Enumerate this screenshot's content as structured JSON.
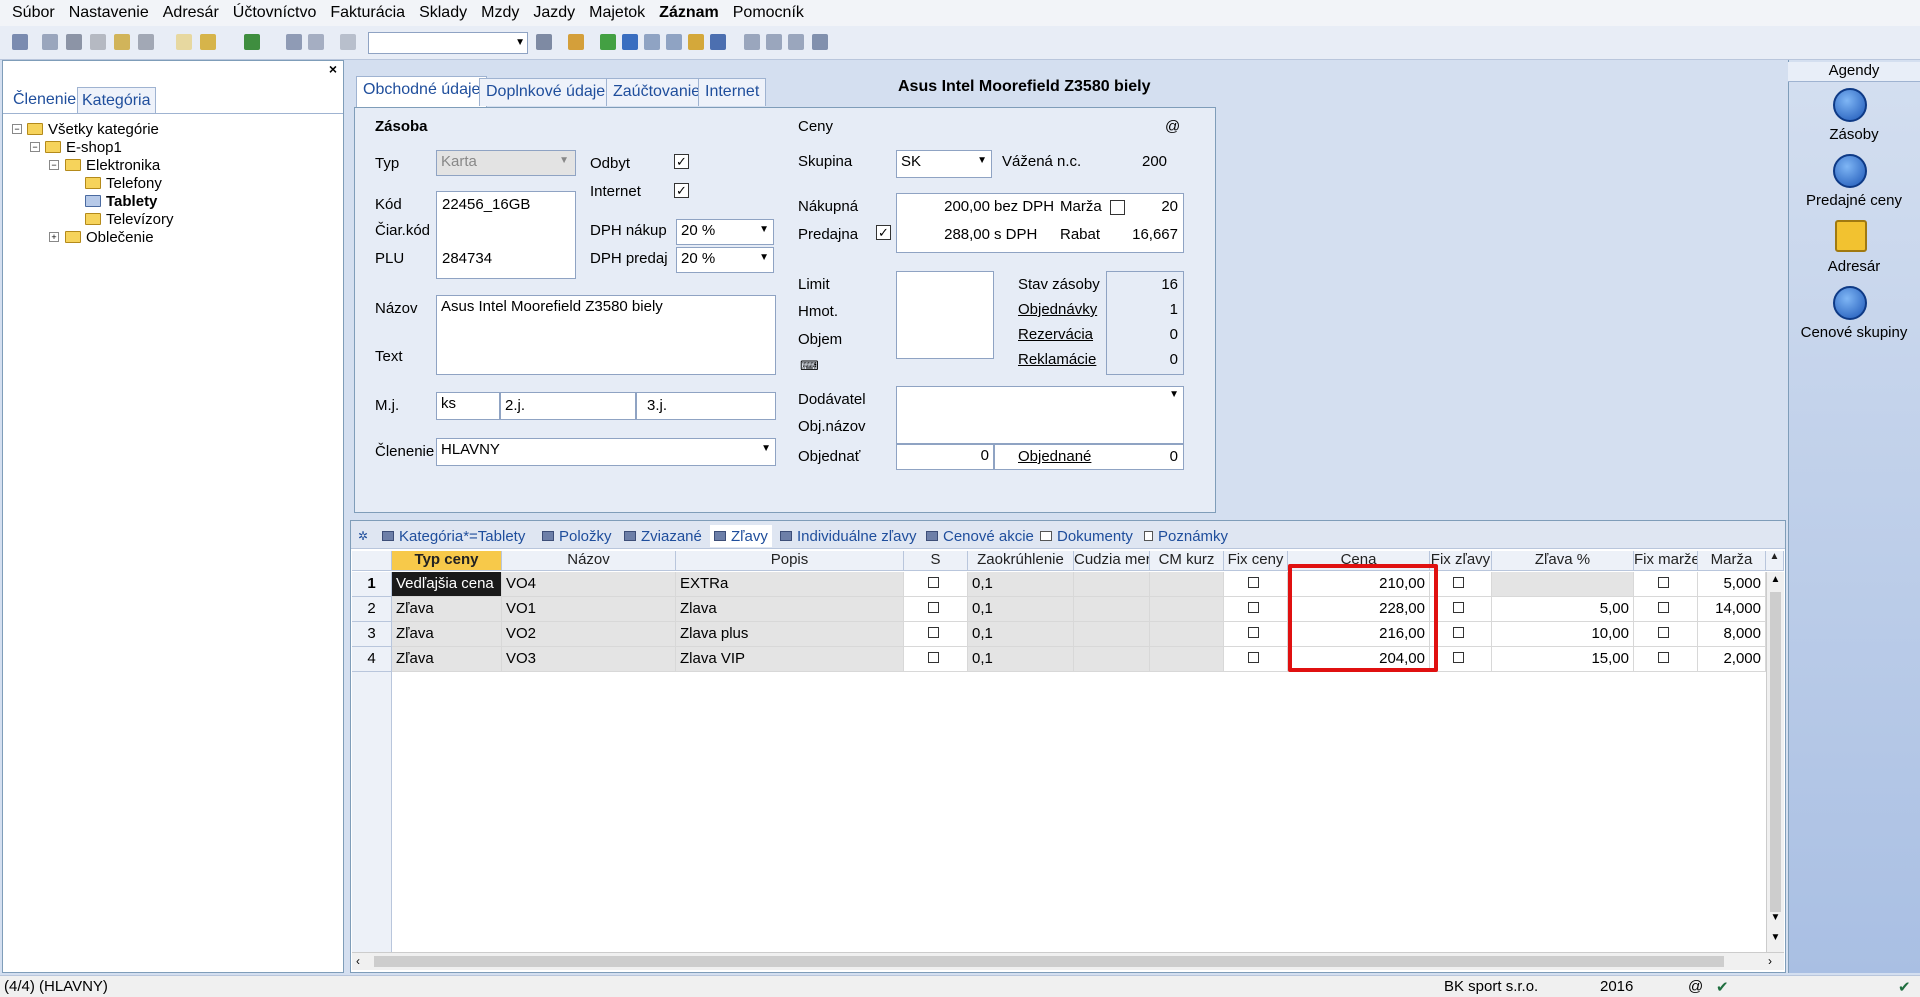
{
  "menu": [
    "Súbor",
    "Nastavenie",
    "Adresár",
    "Účtovníctvo",
    "Fakturácia",
    "Sklady",
    "Mzdy",
    "Jazdy",
    "Majetok",
    "Záznam",
    "Pomocník"
  ],
  "left": {
    "tabs": [
      "Členenie",
      "Kategória"
    ],
    "close": "×",
    "tree": {
      "root": "Všetky kategórie",
      "shop": "E-shop1",
      "elektronika": "Elektronika",
      "telefony": "Telefony",
      "tablety": "Tablety",
      "televizory": "Televízory",
      "oblecenie": "Oblečenie"
    }
  },
  "form": {
    "tabs": [
      "Obchodné údaje",
      "Doplnkové údaje",
      "Zaúčtovanie",
      "Internet"
    ],
    "title": "Asus Intel Moorefield Z3580 biely",
    "zasoba": "Zásoba",
    "typ_label": "Typ",
    "typ_value": "Karta",
    "odbyt_label": "Odbyt",
    "internet_label": "Internet",
    "kod_label": "Kód",
    "kod_value": "22456_16GB",
    "ciar_label": "Čiar.kód",
    "plu_label": "PLU",
    "plu_value": "284734",
    "dph_nakup_label": "DPH nákup",
    "dph_nakup_value": "20 %",
    "dph_predaj_label": "DPH predaj",
    "dph_predaj_value": "20 %",
    "nazov_label": "Názov",
    "nazov_value": "Asus Intel Moorefield Z3580 biely",
    "text_label": "Text",
    "mj_label": "M.j.",
    "mj_value": "ks",
    "j2_label": "2.j.",
    "j3_label": "3.j.",
    "clenenie_label": "Členenie",
    "clenenie_value": "HLAVNY",
    "ceny": "Ceny",
    "at": "@",
    "skupina_label": "Skupina",
    "skupina_value": "SK",
    "vazena_label": "Vážená n.c.",
    "vazena_value": "200",
    "nakupna_label": "Nákupná",
    "nakupna_value": "200,00",
    "bez_dph": "bez DPH",
    "marza_label": "Marža",
    "marza_value": "20",
    "predajna_label": "Predajna",
    "predajna_value": "288,00",
    "s_dph": "s DPH",
    "rabat_label": "Rabat",
    "rabat_value": "16,667",
    "limit_label": "Limit",
    "hmot_label": "Hmot.",
    "objem_label": "Objem",
    "stav_label": "Stav zásoby",
    "stav_value": "16",
    "objednavky_label": "Objednávky",
    "objednavky_value": "1",
    "rezervacia_label": "Rezervácia",
    "rezervacia_value": "0",
    "reklamacie_label": "Reklamácie",
    "reklamacie_value": "0",
    "dodavatel_label": "Dodávatel",
    "objnazov_label": "Obj.názov",
    "objednat_label": "Objednať",
    "objednat_value": "0",
    "objednane_label": "Objednané",
    "objednane_value": "0"
  },
  "grid": {
    "tabs": [
      "Kategória*=Tablety",
      "Položky",
      "Zviazané",
      "Zľavy",
      "Individuálne zľavy",
      "Cenové akcie",
      "Dokumenty",
      "Poznámky"
    ],
    "headers": [
      "Typ ceny",
      "Názov",
      "Popis",
      "S",
      "Zaokrúhlenie",
      "Cudzia mer",
      "CM kurz",
      "Fix ceny",
      "Cena",
      "Fix zľavy",
      "Zľava %",
      "Fix marže",
      "Marža"
    ],
    "rows": [
      {
        "n": "1",
        "typ": "Vedľajšia cena",
        "nazov": "VO4",
        "popis": "EXTRa",
        "zaok": "0,1",
        "cena": "210,00",
        "zlava": "",
        "marza": "5,000"
      },
      {
        "n": "2",
        "typ": "Zľava",
        "nazov": "VO1",
        "popis": "Zlava",
        "zaok": "0,1",
        "cena": "228,00",
        "zlava": "5,00",
        "marza": "14,000"
      },
      {
        "n": "3",
        "typ": "Zľava",
        "nazov": "VO2",
        "popis": "Zlava plus",
        "zaok": "0,1",
        "cena": "216,00",
        "zlava": "10,00",
        "marza": "8,000"
      },
      {
        "n": "4",
        "typ": "Zľava",
        "nazov": "VO3",
        "popis": "Zlava VIP",
        "zaok": "0,1",
        "cena": "204,00",
        "zlava": "15,00",
        "marza": "2,000"
      }
    ]
  },
  "agendy": {
    "title": "Agendy",
    "items": [
      "Zásoby",
      "Predajné ceny",
      "Adresár",
      "Cenové skupiny"
    ]
  },
  "status": {
    "left": "(4/4) (HLAVNY)",
    "company": "BK sport  s.r.o.",
    "year": "2016",
    "at": "@"
  },
  "colors": {
    "highlight": "#e01010",
    "selected_header": "#f7c94a",
    "link": "#1f4e9c"
  }
}
